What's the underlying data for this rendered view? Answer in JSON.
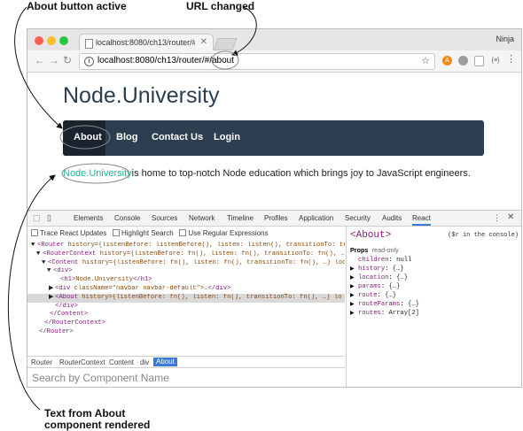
{
  "annotations": {
    "about_active": "About button active",
    "url_changed": "URL changed",
    "text_rendered_line1": "Text from About",
    "text_rendered_line2": "component rendered"
  },
  "browser": {
    "tab_title": "localhost:8080/ch13/router/#/",
    "user": "Ninja",
    "url_prefix": "localhost:8080/ch13/router/#/",
    "url_suffix": "about",
    "back_icon": "back-arrow-icon",
    "forward_icon": "forward-arrow-icon",
    "reload_icon": "reload-icon",
    "star_icon": "star-icon",
    "ext_icons": [
      "extension-orange-icon",
      "extension-gray-icon",
      "extension-page-icon",
      "extension-code-icon"
    ],
    "ext_labels": [
      "A",
      "",
      "",
      "{≡}"
    ],
    "colors": {
      "close": "#ff5f57",
      "minimize": "#febc2e",
      "maximize": "#28c840"
    }
  },
  "page": {
    "brand": "Node.University",
    "nav": [
      "About",
      "Blog",
      "Contact Us",
      "Login"
    ],
    "lead_link": "Node.University",
    "lead_text": "is home to top-notch Node education which brings joy to JavaScript engineers.",
    "colors": {
      "navbar": "#2c3e50",
      "link": "#18bc9c"
    }
  },
  "devtools": {
    "tabs": [
      "Elements",
      "Console",
      "Sources",
      "Network",
      "Timeline",
      "Profiles",
      "Application",
      "Security",
      "Audits",
      "React"
    ],
    "active_tab": "React",
    "options": [
      "Trace React Updates",
      "Highlight Search",
      "Use Regular Expressions"
    ],
    "tree": [
      {
        "arrow": "▼",
        "open": "<Router",
        "attrs": " history={listenBefore: listenBefore(), listen: listen(), transitionTo: tr",
        "close": ""
      },
      {
        "arrow": "▼",
        "open": "<RouterContext",
        "attrs": " history={listenBefore: fn(), listen: fn(), transitionTo: fn(), …",
        "close": ""
      },
      {
        "arrow": "▼",
        "open": "<Content",
        "attrs": " history={listenBefore: fn(), listen: fn(), transitionTo: fn(), …} loc",
        "close": ""
      },
      {
        "arrow": "▼",
        "open": "<div>",
        "attrs": "",
        "close": ""
      },
      {
        "arrow": "",
        "open": "<h1>",
        "attrs": "Node.University",
        "close": "</h1>"
      },
      {
        "arrow": "▶",
        "open": "<div",
        "attrs": " className=\"navbar navbar-default\">…",
        "close": "</div>"
      },
      {
        "arrow": "▶",
        "open": "<About",
        "attrs": " history={listenBefore: fn(), listen: fn(), transitionTo: fn(), …} lo",
        "close": ""
      },
      {
        "arrow": "",
        "open": "</div>",
        "attrs": "",
        "close": ""
      },
      {
        "arrow": "",
        "open": "</Content>",
        "attrs": "",
        "close": ""
      },
      {
        "arrow": "",
        "open": "</RouterContext>",
        "attrs": "",
        "close": ""
      },
      {
        "arrow": "",
        "open": "</Router>",
        "attrs": "",
        "close": ""
      }
    ],
    "breadcrumbs": [
      "Router",
      "RouterContext",
      "Content",
      "div",
      "About"
    ],
    "search_placeholder": "Search by Component Name",
    "selected": {
      "title": "<About>",
      "hint": "($r in the console)",
      "props_header": "Props",
      "props_readonly": "read-only",
      "props": [
        {
          "arrow": "",
          "key": "children",
          "val": "null"
        },
        {
          "arrow": "▶",
          "key": "history",
          "val": "{…}"
        },
        {
          "arrow": "▶",
          "key": "location",
          "val": "{…}"
        },
        {
          "arrow": "▶",
          "key": "params",
          "val": "{…}"
        },
        {
          "arrow": "▶",
          "key": "route",
          "val": "{…}"
        },
        {
          "arrow": "▶",
          "key": "routeParams",
          "val": "{…}"
        },
        {
          "arrow": "▶",
          "key": "routes",
          "val": "Array[2]"
        }
      ]
    }
  }
}
